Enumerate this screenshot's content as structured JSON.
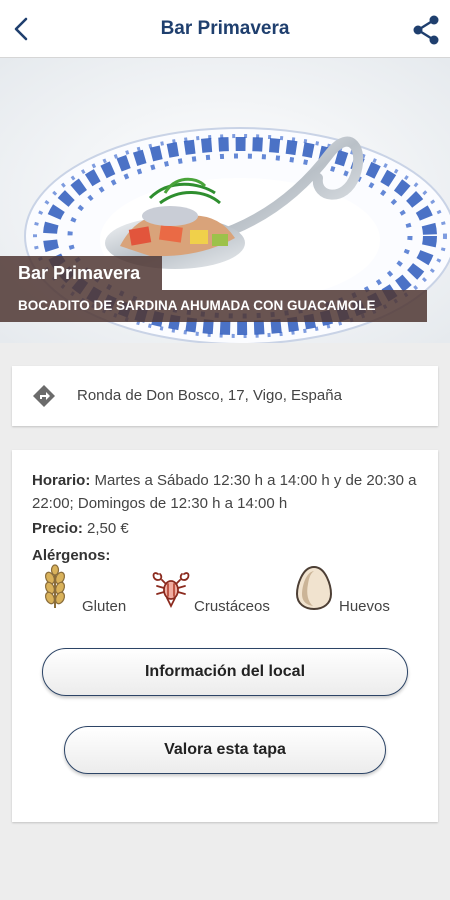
{
  "header": {
    "title": "Bar Primavera",
    "back_icon": "chevron-left-icon",
    "share_icon": "share-icon",
    "accent_color": "#1f3f6e"
  },
  "hero": {
    "bar_name": "Bar Primavera",
    "dish_name": "BOCADITO DE SARDINA AHUMADA CON GUACAMOLE"
  },
  "address": {
    "icon": "directions-icon",
    "text": "Ronda de Don Bosco, 17, Vigo, España"
  },
  "details": {
    "schedule_label": "Horario:",
    "schedule_value": " Martes a Sábado 12:30 h a 14:00 h y de 20:30 a 22:00; Domingos de 12:30 h a 14:00 h",
    "price_label": "Precio:",
    "price_value": " 2,50 €",
    "allergens_label": "Alérgenos:",
    "allergens": [
      {
        "icon": "wheat-icon",
        "label": "Gluten"
      },
      {
        "icon": "lobster-icon",
        "label": "Crustáceos"
      },
      {
        "icon": "egg-icon",
        "label": "Huevos"
      }
    ]
  },
  "buttons": {
    "info": "Información del local",
    "rate": "Valora esta tapa"
  }
}
